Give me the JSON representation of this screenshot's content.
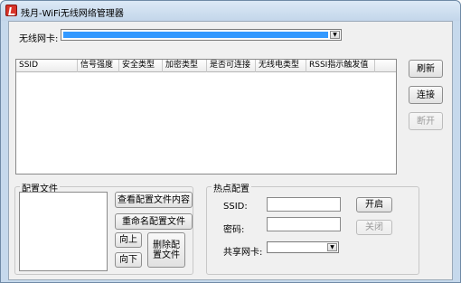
{
  "window": {
    "title": "残月-WiFi无线网络管理器"
  },
  "adapter": {
    "label": "无线网卡:"
  },
  "network_list": {
    "columns": [
      "SSID",
      "信号强度",
      "安全类型",
      "加密类型",
      "是否可连接",
      "无线电类型",
      "RSSI指示触发值"
    ]
  },
  "side_buttons": {
    "refresh": "刷新",
    "connect": "连接",
    "disconnect": "断开"
  },
  "profile": {
    "group_title": "配置文件",
    "view": "查看配置文件内容",
    "rename": "重命名配置文件",
    "up": "向上",
    "down": "向下",
    "delete": "删除配置文件"
  },
  "hotspot": {
    "group_title": "热点配置",
    "ssid_label": "SSID:",
    "password_label": "密码:",
    "share_label": "共享网卡:",
    "start": "开启",
    "stop": "关闭"
  }
}
